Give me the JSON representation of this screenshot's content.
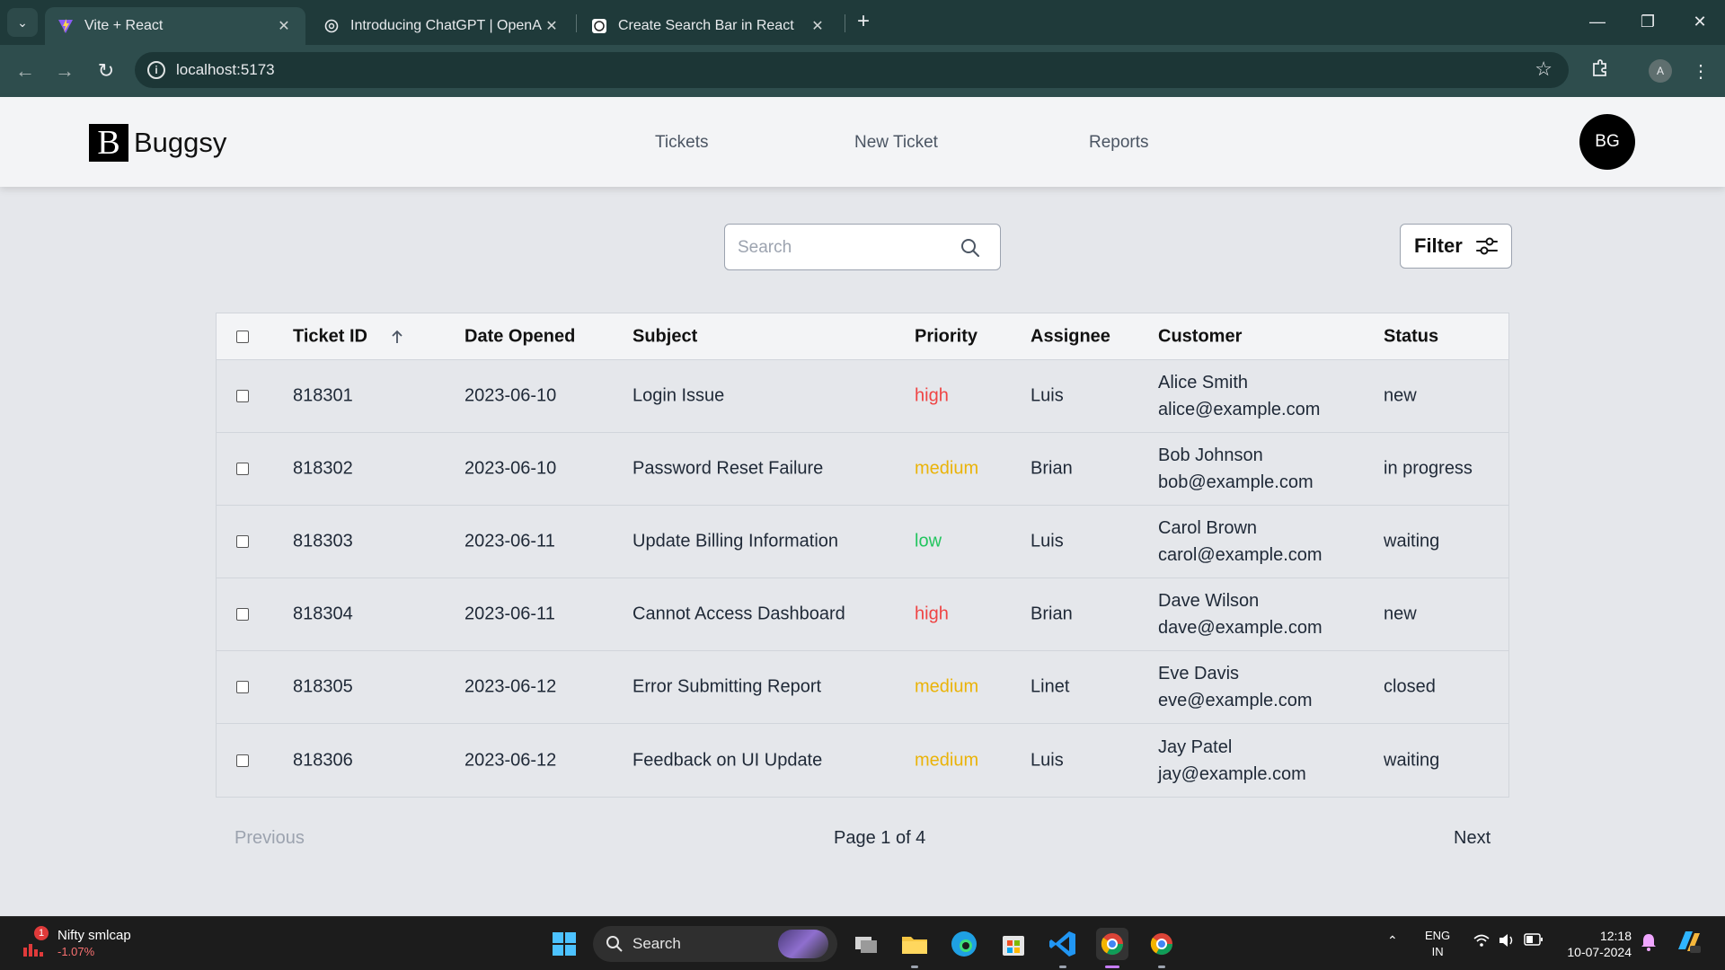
{
  "browser": {
    "tabs": [
      {
        "title": "Vite + React",
        "active": true
      },
      {
        "title": "Introducing ChatGPT | OpenAI",
        "active": false
      },
      {
        "title": "Create Search Bar in React",
        "active": false
      }
    ],
    "url": "localhost:5173",
    "profile_initial": "A"
  },
  "app": {
    "logo_letter": "B",
    "logo_name": "Buggsy",
    "nav": [
      "Tickets",
      "New Ticket",
      "Reports"
    ],
    "avatar_initials": "BG",
    "search_placeholder": "Search",
    "filter_label": "Filter"
  },
  "table": {
    "columns": [
      "Ticket ID",
      "Date Opened",
      "Subject",
      "Priority",
      "Assignee",
      "Customer",
      "Status"
    ],
    "rows": [
      {
        "id": "818301",
        "date": "2023-06-10",
        "subject": "Login Issue",
        "priority": "high",
        "assignee": "Luis",
        "customer_name": "Alice Smith",
        "customer_email": "alice@example.com",
        "status": "new"
      },
      {
        "id": "818302",
        "date": "2023-06-10",
        "subject": "Password Reset Failure",
        "priority": "medium",
        "assignee": "Brian",
        "customer_name": "Bob Johnson",
        "customer_email": "bob@example.com",
        "status": "in progress"
      },
      {
        "id": "818303",
        "date": "2023-06-11",
        "subject": "Update Billing Information",
        "priority": "low",
        "assignee": "Luis",
        "customer_name": "Carol Brown",
        "customer_email": "carol@example.com",
        "status": "waiting"
      },
      {
        "id": "818304",
        "date": "2023-06-11",
        "subject": "Cannot Access Dashboard",
        "priority": "high",
        "assignee": "Brian",
        "customer_name": "Dave Wilson",
        "customer_email": "dave@example.com",
        "status": "new"
      },
      {
        "id": "818305",
        "date": "2023-06-12",
        "subject": "Error Submitting Report",
        "priority": "medium",
        "assignee": "Linet",
        "customer_name": "Eve Davis",
        "customer_email": "eve@example.com",
        "status": "closed"
      },
      {
        "id": "818306",
        "date": "2023-06-12",
        "subject": "Feedback on UI Update",
        "priority": "medium",
        "assignee": "Luis",
        "customer_name": "Jay Patel",
        "customer_email": "jay@example.com",
        "status": "waiting"
      }
    ]
  },
  "pagination": {
    "previous": "Previous",
    "info": "Page 1 of 4",
    "next": "Next"
  },
  "taskbar": {
    "ticker_badge": "1",
    "ticker_name": "Nifty smlcap",
    "ticker_change": "-1.07%",
    "search_label": "Search",
    "lang_line1": "ENG",
    "lang_line2": "IN",
    "time": "12:18",
    "date": "10-07-2024"
  },
  "colors": {
    "priority_high": "#ef4444",
    "priority_medium": "#eab308",
    "priority_low": "#22c55e",
    "chrome_frame": "#1f3a3a"
  }
}
